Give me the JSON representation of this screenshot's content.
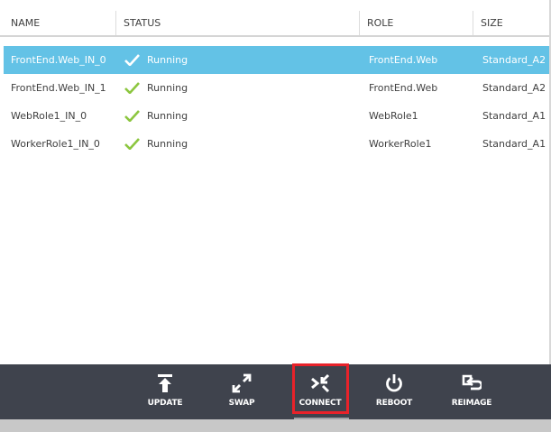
{
  "table": {
    "columns": {
      "name": "NAME",
      "status": "STATUS",
      "role": "ROLE",
      "size": "SIZE"
    },
    "rows": [
      {
        "name": "FrontEnd.Web_IN_0",
        "status": "Running",
        "role": "FrontEnd.Web",
        "size": "Standard_A2",
        "selected": true
      },
      {
        "name": "FrontEnd.Web_IN_1",
        "status": "Running",
        "role": "FrontEnd.Web",
        "size": "Standard_A2",
        "selected": false
      },
      {
        "name": "WebRole1_IN_0",
        "status": "Running",
        "role": "WebRole1",
        "size": "Standard_A1",
        "selected": false
      },
      {
        "name": "WorkerRole1_IN_0",
        "status": "Running",
        "role": "WorkerRole1",
        "size": "Standard_A1",
        "selected": false
      }
    ]
  },
  "toolbar": {
    "update": {
      "label": "UPDATE",
      "icon": "upload-arrow-icon"
    },
    "swap": {
      "label": "SWAP",
      "icon": "swap-arrows-icon"
    },
    "connect": {
      "label": "CONNECT",
      "icon": "remote-connect-icon"
    },
    "reboot": {
      "label": "REBOOT",
      "icon": "power-icon"
    },
    "reimage": {
      "label": "REIMAGE",
      "icon": "reimage-icon"
    }
  },
  "colors": {
    "selected_row": "#63c2e6",
    "check": "#8cc63f",
    "toolbar_bg": "#3f434d",
    "highlight": "#e8222a"
  }
}
